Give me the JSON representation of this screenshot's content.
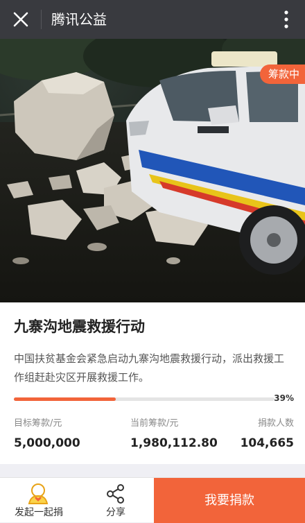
{
  "header": {
    "title": "腾讯公益",
    "close_icon": "close-icon",
    "more_icon": "more-vertical-icon"
  },
  "hero": {
    "status_badge": "筹款中",
    "image": "earthquake-rockfall-taxi-photo"
  },
  "project": {
    "title": "九寨沟地震救援行动",
    "description": "中国扶贫基金会紧急启动九寨沟地震救援行动，派出救援工作组赶赴灾区开展救援工作。",
    "progress_fraction": 0.39,
    "progress_label": "39%",
    "stats": [
      {
        "label": "目标筹款/元",
        "value": "5,000,000"
      },
      {
        "label": "当前筹款/元",
        "value": "1,980,112.80"
      },
      {
        "label": "捐款人数",
        "value": "104,665"
      }
    ]
  },
  "bottom": {
    "initiate_label": "发起一起捐",
    "share_label": "分享",
    "donate_label": "我要捐款"
  },
  "colors": {
    "accent": "#f2643a",
    "topbar": "#393a3f"
  }
}
